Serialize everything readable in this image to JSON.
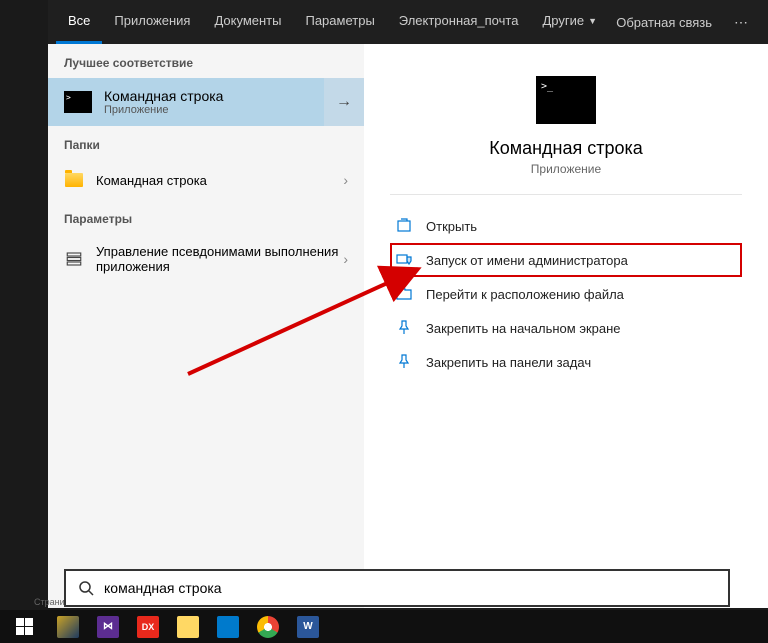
{
  "tabs": {
    "items": [
      "Все",
      "Приложения",
      "Документы",
      "Параметры",
      "Электронная_почта",
      "Другие"
    ],
    "feedback": "Обратная связь"
  },
  "left": {
    "bestMatchHeader": "Лучшее соответствие",
    "bestMatch": {
      "title": "Командная строка",
      "sub": "Приложение"
    },
    "foldersHeader": "Папки",
    "folderItem": "Командная строка",
    "paramsHeader": "Параметры",
    "paramsItem": "Управление псевдонимами выполнения приложения"
  },
  "preview": {
    "title": "Командная строка",
    "sub": "Приложение",
    "actions": [
      "Открыть",
      "Запуск от имени администратора",
      "Перейти к расположению файла",
      "Закрепить на начальном экране",
      "Закрепить на панели задач"
    ]
  },
  "search": {
    "value": "командная строка",
    "placeholder": ""
  },
  "pageLabel": "Страни",
  "taskbarApps": [
    "league",
    "vs",
    "dx",
    "explorer",
    "vscode",
    "chrome",
    "word"
  ]
}
